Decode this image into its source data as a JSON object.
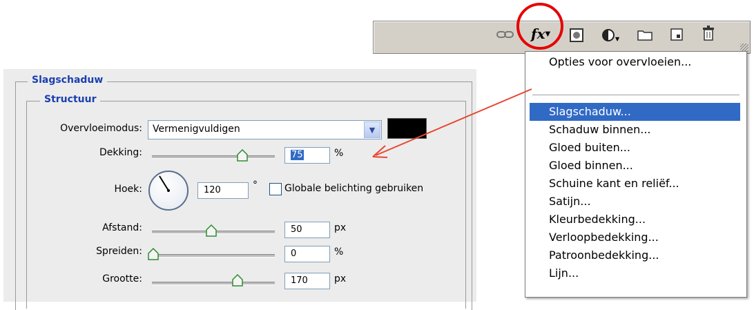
{
  "toolbar": {
    "icons": [
      "link-icon",
      "fx-icon",
      "mask-icon",
      "adjustment-layer-icon",
      "folder-icon",
      "new-layer-icon",
      "trash-icon"
    ],
    "fx_label": "fx",
    "highlight_color": "#e60000"
  },
  "menu": {
    "items": [
      {
        "label": "Opties voor overvloeien..."
      },
      {
        "label": "Slagschaduw..."
      },
      {
        "label": "Schaduw binnen..."
      },
      {
        "label": "Gloed buiten..."
      },
      {
        "label": "Gloed binnen..."
      },
      {
        "label": "Schuine kant en reliëf..."
      },
      {
        "label": "Satijn..."
      },
      {
        "label": "Kleurbedekking..."
      },
      {
        "label": "Verloopbedekking..."
      },
      {
        "label": "Patroonbedekking..."
      },
      {
        "label": "Lijn..."
      }
    ],
    "selected_index": 1,
    "selected_color": "#316ac5"
  },
  "dialog": {
    "section_title": "Slagschaduw",
    "subsection_title": "Structuur",
    "blend_mode": {
      "label": "Overvloeimodus:",
      "value": "Vermenigvuldigen",
      "color_swatch": "#000000"
    },
    "opacity": {
      "label": "Dekking:",
      "value": "75",
      "unit": "%"
    },
    "angle": {
      "label": "Hoek:",
      "value": "120",
      "unit": "°",
      "checkbox_label": "Globale belichting gebruiken",
      "checked": false
    },
    "distance": {
      "label": "Afstand:",
      "value": "50",
      "unit": "px"
    },
    "spread": {
      "label": "Spreiden:",
      "value": "0",
      "unit": "%"
    },
    "size": {
      "label": "Grootte:",
      "value": "170",
      "unit": "px"
    }
  }
}
